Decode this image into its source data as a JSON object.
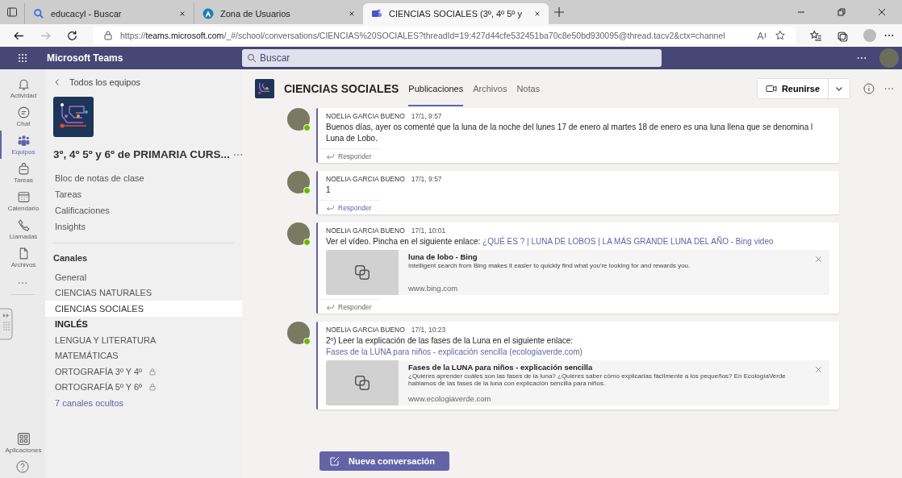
{
  "browser": {
    "tabs": [
      {
        "title": "educacyl - Buscar",
        "selected": false
      },
      {
        "title": "Zona de Usuarios",
        "selected": false
      },
      {
        "title": "CIENCIAS SOCIALES (3º, 4º 5º y",
        "selected": true
      }
    ],
    "url_prefix": "https://",
    "url_host": "teams.microsoft.com",
    "url_path": "/_#/school/conversations/CIENCIAS%20SOCIALES?threadId=19:427d44cfe532451ba70c8e50bd930095@thread.tacv2&ctx=channel"
  },
  "app": {
    "title": "Microsoft Teams",
    "search_placeholder": "Buscar"
  },
  "rail": {
    "items": [
      {
        "label": "Actividad",
        "selected": false
      },
      {
        "label": "Chat",
        "selected": false
      },
      {
        "label": "Equipos",
        "selected": true
      },
      {
        "label": "Tareas",
        "selected": false
      },
      {
        "label": "Calendario",
        "selected": false
      },
      {
        "label": "Llamadas",
        "selected": false
      },
      {
        "label": "Archivos",
        "selected": false
      }
    ],
    "apps_label": "Aplicaciones"
  },
  "sidebar": {
    "back": "Todos los equipos",
    "team_name": "3º, 4º 5º y 6º de PRIMARIA CURS...",
    "links": [
      "Bloc de notas de clase",
      "Tareas",
      "Calificaciones",
      "Insights"
    ],
    "channels_heading": "Canales",
    "channels": [
      {
        "name": "General",
        "selected": false,
        "unread": false,
        "private": false
      },
      {
        "name": "CIENCIAS NATURALES",
        "selected": false,
        "unread": false,
        "private": false
      },
      {
        "name": "CIENCIAS SOCIALES",
        "selected": true,
        "unread": false,
        "private": false
      },
      {
        "name": "INGLÉS",
        "selected": false,
        "unread": true,
        "private": false
      },
      {
        "name": "LENGUA Y LITERATURA",
        "selected": false,
        "unread": false,
        "private": false
      },
      {
        "name": "MATEMÁTICAS",
        "selected": false,
        "unread": false,
        "private": false
      },
      {
        "name": "ORTOGRAFÍA 3º Y 4º",
        "selected": false,
        "unread": false,
        "private": true
      },
      {
        "name": "ORTOGRAFÍA 5º Y 6º",
        "selected": false,
        "unread": false,
        "private": true
      }
    ],
    "hidden_channels": "7 canales ocultos"
  },
  "channel": {
    "title": "CIENCIAS SOCIALES",
    "tabs": [
      {
        "label": "Publicaciones",
        "selected": true
      },
      {
        "label": "Archivos",
        "selected": false
      },
      {
        "label": "Notas",
        "selected": false
      }
    ],
    "meet_button": "Reunirse",
    "posts": [
      {
        "author": "NOELIA GARCIA BUENO",
        "time": "17/1, 9:57",
        "text": "Buenos días, ayer os comenté que la luna de la noche del lunes 17 de enero al martes 18 de enero es una luna llena que se denomina l Luna de Lobo.",
        "reply": "Responder",
        "reply_highlighted": false
      },
      {
        "author": "NOELIA GARCIA BUENO",
        "time": "17/1, 9:57",
        "text": "1",
        "reply": "Responder",
        "reply_highlighted": true
      },
      {
        "author": "NOELIA GARCIA BUENO",
        "time": "17/1, 10:01",
        "text": "Ver el vídeo. Pincha en el siguiente enlace:",
        "link": "¿QUÉ ES ? | LUNA DE LOBOS | LA MÁS GRANDE LUNA DEL AÑO - Bing video",
        "preview": {
          "title": "luna de lobo - Bing",
          "description": "Intelligent search from Bing makes it easier to quickly find what you're looking for and rewards you.",
          "site": "www.bing.com"
        },
        "reply": "Responder",
        "reply_highlighted": false
      },
      {
        "author": "NOELIA GARCIA BUENO",
        "time": "17/1, 10:23",
        "text": "2º) Leer la explicación de las fases de la Luna en el siguiente enlace:",
        "link": "Fases de la LUNA para niños - explicación sencilla (ecologiaverde.com)",
        "preview": {
          "title": "Fases de la LUNA para niños - explicación sencilla",
          "description": "¿Quieres aprender cuáles son las fases de la luna? ¿Quieres saber cómo explicarlas fácilmente a los pequeños? En EcologíaVerde hablamos de las fases de la luna con explicación sencilla para niños.",
          "site": "www.ecologiaverde.com"
        }
      }
    ],
    "new_conversation": "Nueva conversación"
  }
}
